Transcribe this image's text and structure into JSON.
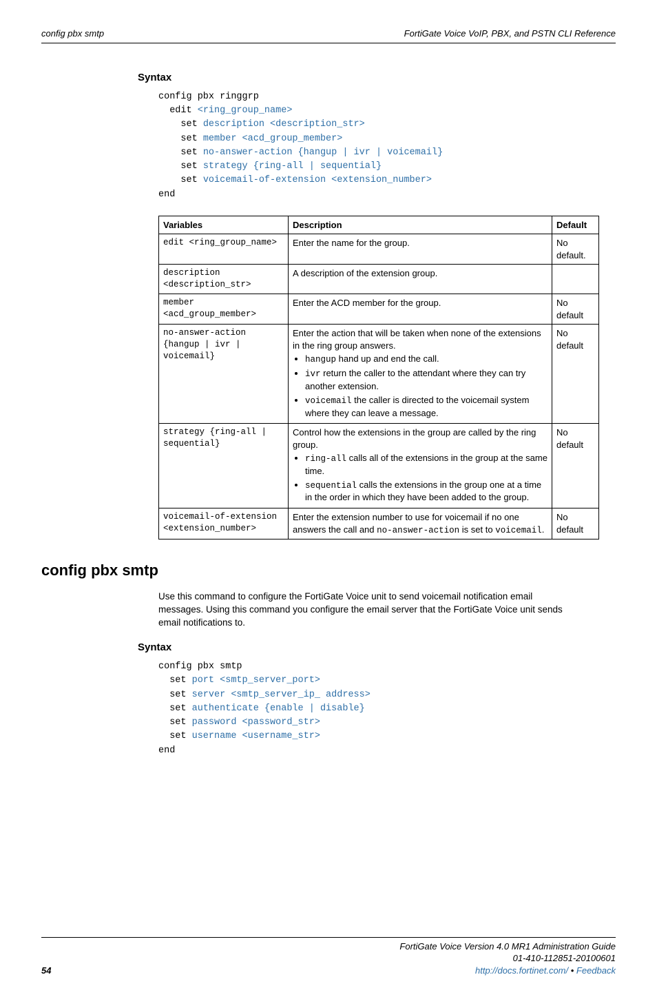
{
  "header": {
    "left": "config pbx smtp",
    "right": "FortiGate Voice VoIP, PBX, and PSTN CLI Reference"
  },
  "syntax1_heading": "Syntax",
  "code1": {
    "l1a": "config pbx ringgrp",
    "l2a": "  edit ",
    "l2b": "<ring_group_name>",
    "l3a": "    set ",
    "l3b": "description <description_str>",
    "l4a": "    set ",
    "l4b": "member <acd_group_member>",
    "l5a": "    set ",
    "l5b": "no-answer-action {hangup | ivr | voicemail}",
    "l6a": "    set ",
    "l6b": "strategy {ring-all | sequential}",
    "l7a": "    set ",
    "l7b": "voicemail-of-extension <extension_number>",
    "l8a": "end"
  },
  "table": {
    "h1": "Variables",
    "h2": "Description",
    "h3": "Default",
    "rows": [
      {
        "var": "edit <ring_group_name>",
        "desc": "Enter the name for the group.",
        "def": "No default."
      },
      {
        "var": "description <description_str>",
        "desc": "A description of the extension group.",
        "def": ""
      },
      {
        "var": "member <acd_group_member>",
        "desc": "Enter the ACD member for the group.",
        "def": "No default"
      },
      {
        "var": "no-answer-action {hangup | ivr | voicemail}",
        "desc_intro": "Enter the action that will be taken when none of the extensions in the ring group answers.",
        "b1_code": "hangup",
        "b1_text": " hand up and end the call.",
        "b2_code": "ivr",
        "b2_text": " return the caller to the attendant where they can try another extension.",
        "b3_code": "voicemail",
        "b3_text": " the caller is directed to the voicemail system where they can leave a message.",
        "def": "No default"
      },
      {
        "var": "strategy {ring-all | sequential}",
        "desc_intro": "Control how the extensions in the group are called by the ring group.",
        "b1_code": "ring-all",
        "b1_text": " calls all of the extensions in the group at the same time.",
        "b2_code": "sequential",
        "b2_text": " calls the extensions in the group one at a time in the order in which they have been added to the group.",
        "def": "No default"
      },
      {
        "var": "voicemail-of-extension <extension_number>",
        "desc_p1": "Enter the extension number to use for voicemail if no one answers the call and ",
        "desc_code1": "no-answer-action",
        "desc_p2": " is set to ",
        "desc_code2": "voicemail",
        "desc_p3": ".",
        "def": "No default"
      }
    ]
  },
  "section_heading": "config pbx smtp",
  "section_body": "Use this command to configure the FortiGate Voice unit to send voicemail notification email messages. Using this command you configure the email server that the FortiGate Voice unit sends email notifications to.",
  "syntax2_heading": "Syntax",
  "code2": {
    "l1a": "config pbx smtp",
    "l2a": "  set ",
    "l2b": "port <smtp_server_port>",
    "l3a": "  set ",
    "l3b": "server <smtp_server_ip_ address>",
    "l4a": "  set ",
    "l4b": "authenticate {enable | disable}",
    "l5a": "  set ",
    "l5b": "password <password_str>",
    "l6a": "  set ",
    "l6b": "username <username_str>",
    "l7a": "end"
  },
  "footer": {
    "page": "54",
    "line1": "FortiGate Voice Version 4.0 MR1 Administration Guide",
    "line2": "01-410-112851-20100601",
    "link": "http://docs.fortinet.com/",
    "sep": " • ",
    "feedback": "Feedback"
  }
}
